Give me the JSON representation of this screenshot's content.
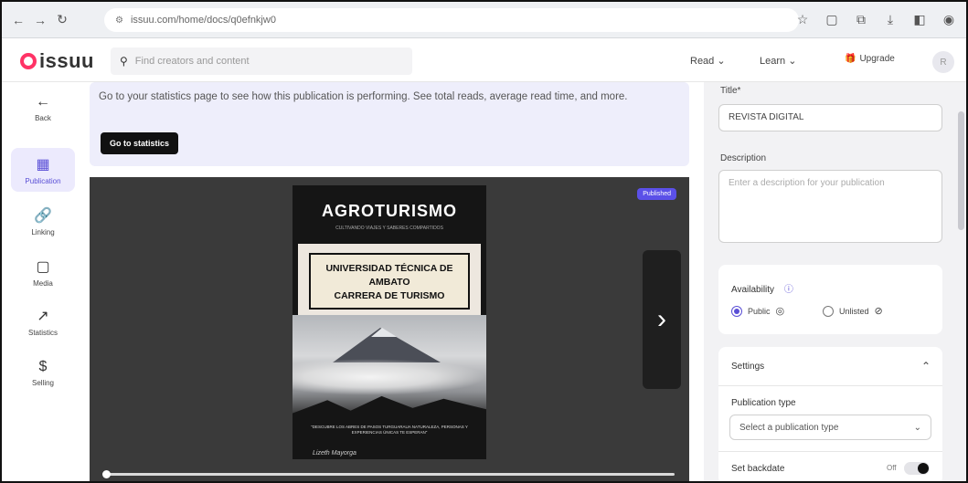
{
  "browser": {
    "url": "issuu.com/home/docs/q0efnkjw0",
    "icons": [
      "back-icon",
      "forward-icon",
      "reload-icon",
      "star-icon",
      "extension-icon",
      "puzzle-icon",
      "download-icon",
      "sidebar-icon",
      "profile-icon"
    ]
  },
  "header": {
    "logo": "issuu",
    "search_placeholder": "Find creators and content",
    "nav_read": "Read",
    "nav_learn": "Learn",
    "upgrade": "Upgrade",
    "avatar": "R"
  },
  "sidebar": {
    "items": [
      {
        "label": "Back",
        "icon": "←"
      },
      {
        "label": "Publication",
        "icon": "▦"
      },
      {
        "label": "Linking",
        "icon": "🔗"
      },
      {
        "label": "Media",
        "icon": "▢"
      },
      {
        "label": "Statistics",
        "icon": "↗"
      },
      {
        "label": "Selling",
        "icon": "$"
      }
    ]
  },
  "banner": {
    "text": "Go to your statistics page to see how this publication is performing. See total reads, average read time, and more.",
    "button": "Go to statistics"
  },
  "viewer": {
    "badge": "Published",
    "cover_title": "AGROTURISMO",
    "cover_subtitle": "CULTIVANDO VIAJES Y SABERES COMPARTIDOS",
    "cover_plate": [
      "UNIVERSIDAD TÉCNICA DE",
      "AMBATO",
      "CARRERA DE TURISMO"
    ],
    "cover_quote": "\"DESCUBRE LOS ABRES DE PASOS TURGUARAUA NATURALEZA, PERSONAS Y EXPERIENCIAS ÚNICAS TE ESPERAN\"",
    "cover_sign": "Lizeth Mayorga",
    "progress": 0
  },
  "panel": {
    "title_label": "Title*",
    "title_value": "REVISTA DIGITAL",
    "description_label": "Description",
    "description_placeholder": "Enter a description for your publication",
    "availability_label": "Availability",
    "availability_info": "ⓘ",
    "public_label": "Public",
    "unlisted_label": "Unlisted",
    "settings_label": "Settings",
    "settings_chevron": "⌃",
    "pubtype_label": "Publication type",
    "pubtype_placeholder": "Select a publication type",
    "backdate_label": "Set backdate",
    "backdate_state": "Off"
  }
}
